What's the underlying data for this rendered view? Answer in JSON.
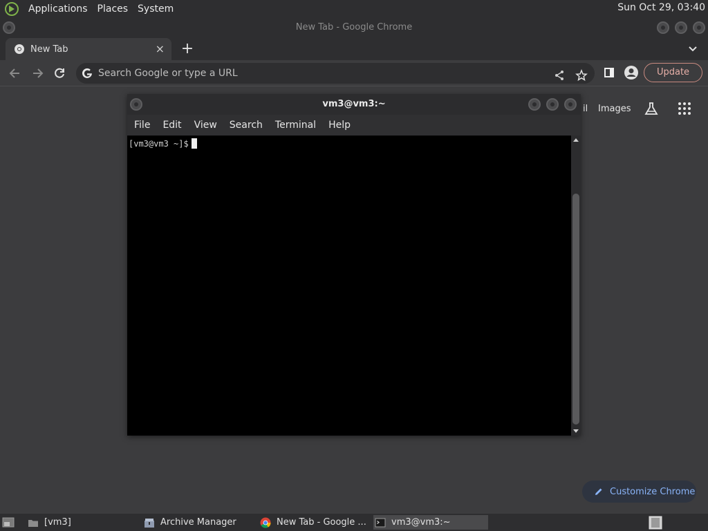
{
  "top_panel": {
    "menus": [
      "Applications",
      "Places",
      "System"
    ],
    "clock": "Sun Oct 29, 03:40"
  },
  "chrome": {
    "window_title": "New Tab - Google Chrome",
    "tab_title": "New Tab",
    "tab_close": "×",
    "new_tab": "+",
    "omnibox_placeholder": "Search Google or type a URL",
    "update_label": "Update",
    "ntp_gmail_partial": "il",
    "ntp_images": "Images",
    "customize_label": "Customize Chrome"
  },
  "terminal": {
    "title": "vm3@vm3:~",
    "menus": [
      "File",
      "Edit",
      "View",
      "Search",
      "Terminal",
      "Help"
    ],
    "prompt": "[vm3@vm3 ~]$"
  },
  "taskbar": {
    "items": [
      "[vm3]",
      "Archive Manager",
      "New Tab - Google ...",
      "vm3@vm3:~"
    ]
  },
  "colors": {
    "panel_bg": "#2e2e30",
    "window_bg": "#3c3c3e",
    "terminal_bg": "#000000",
    "update_accent": "#e8b0a8",
    "customize_accent": "#8ab4f8"
  }
}
